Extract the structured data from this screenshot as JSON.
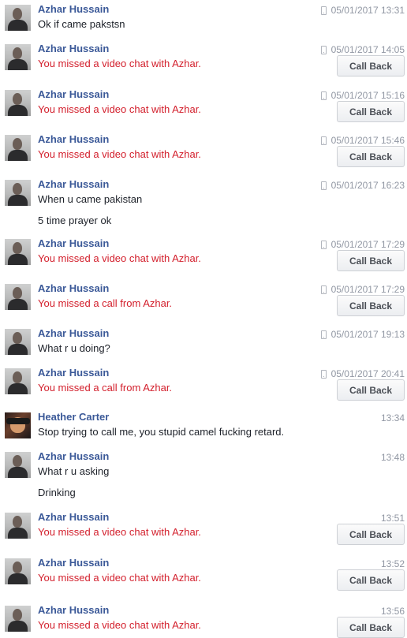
{
  "call_back_label": "Call Back",
  "messages": [
    {
      "sender": "Azhar Hussain",
      "time": "05/01/2017 13:31",
      "lines": [
        "Ok if  came pakstsn"
      ]
    },
    {
      "sender": "Azhar Hussain",
      "time": "05/01/2017 14:05",
      "lines": [
        "You missed a video chat with Azhar."
      ]
    },
    {
      "sender": "Azhar Hussain",
      "time": "05/01/2017 15:16",
      "lines": [
        "You missed a video chat with Azhar."
      ]
    },
    {
      "sender": "Azhar Hussain",
      "time": "05/01/2017 15:46",
      "lines": [
        "You missed a video chat with Azhar."
      ]
    },
    {
      "sender": "Azhar Hussain",
      "time": "05/01/2017 16:23",
      "lines": [
        "When u came pakistan",
        "5 time prayer ok"
      ]
    },
    {
      "sender": "Azhar Hussain",
      "time": "05/01/2017 17:29",
      "lines": [
        "You missed a video chat with Azhar."
      ]
    },
    {
      "sender": "Azhar Hussain",
      "time": "05/01/2017 17:29",
      "lines": [
        "You missed a call from Azhar."
      ]
    },
    {
      "sender": "Azhar Hussain",
      "time": "05/01/2017 19:13",
      "lines": [
        "What r u doing?"
      ]
    },
    {
      "sender": "Azhar Hussain",
      "time": "05/01/2017 20:41",
      "lines": [
        "You missed a call from Azhar."
      ]
    },
    {
      "sender": "Heather Carter",
      "time": "13:34",
      "lines": [
        "Stop trying to call me, you stupid camel fucking retard."
      ]
    },
    {
      "sender": "Azhar Hussain",
      "time": "13:48",
      "lines": [
        "What r u asking",
        "Drinking"
      ]
    },
    {
      "sender": "Azhar Hussain",
      "time": "13:51",
      "lines": [
        "You missed a video chat with Azhar."
      ]
    },
    {
      "sender": "Azhar Hussain",
      "time": "13:52",
      "lines": [
        "You missed a video chat with Azhar."
      ]
    },
    {
      "sender": "Azhar Hussain",
      "time": "13:56",
      "lines": [
        "You missed a video chat with Azhar."
      ]
    }
  ]
}
